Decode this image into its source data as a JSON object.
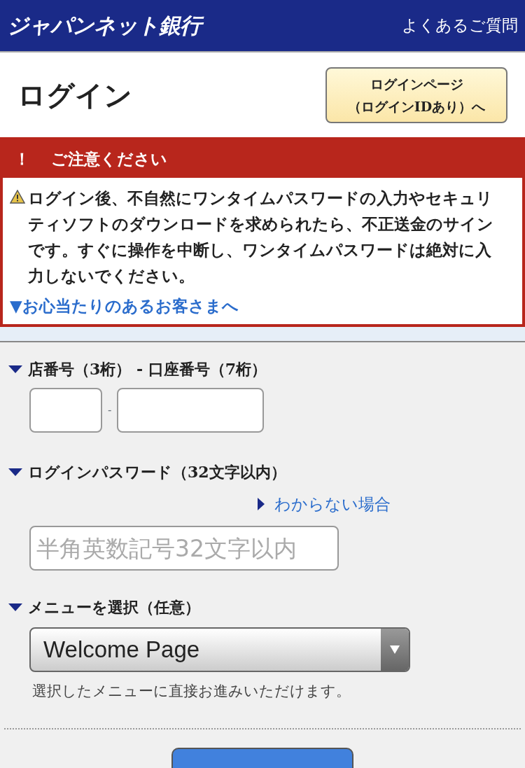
{
  "header": {
    "logo": "ジャパンネット銀行",
    "faq_link": "よくあるご質問"
  },
  "page": {
    "title": "ログイン",
    "alt_login_button": [
      "ログインページ",
      "（ログインIDあり）へ"
    ]
  },
  "alert": {
    "mark": "！",
    "title": "ご注意ください",
    "message": "ログイン後、不自然にワンタイムパスワードの入力やセキュリティソフトのダウンロードを求められたら、不正送金のサインです。すぐに操作を中断し、ワンタイムパスワードは絶対に入力しないでください。",
    "link": "▼お心当たりのあるお客さまへ"
  },
  "form": {
    "account_label": "店番号（3桁） - 口座番号（7桁）",
    "separator": "-",
    "password_label": "ログインパスワード（32文字以内）",
    "help_link": "わからない場合",
    "password_placeholder": "半角英数記号32文字以内",
    "menu_label": "メニューを選択（任意）",
    "menu_value": "Welcome Page",
    "menu_note": "選択したメニューに直接お進みいただけます。"
  }
}
